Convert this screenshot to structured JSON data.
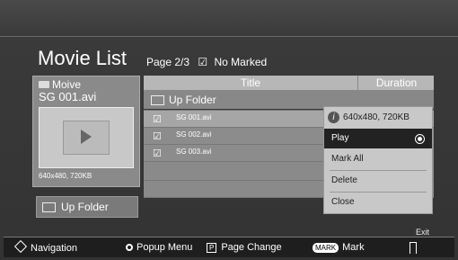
{
  "header": {
    "title": "Movie List",
    "page": "Page 2/3",
    "marked": "No Marked"
  },
  "preview": {
    "folder": "Moive",
    "filename": "SG 001.avi",
    "resolution": "640x480, 720KB"
  },
  "left_button": {
    "label": "Up Folder"
  },
  "list": {
    "col_title": "Title",
    "col_duration": "Duration",
    "up_folder": "Up Folder",
    "items": [
      {
        "name": "SG 001.avi"
      },
      {
        "name": "SG 002.avi"
      },
      {
        "name": "SG 003.avi"
      }
    ]
  },
  "popup": {
    "info": "640x480, 720KB",
    "items": [
      {
        "label": "Play"
      },
      {
        "label": "Mark All"
      },
      {
        "label": "Delete"
      },
      {
        "label": "Close"
      }
    ]
  },
  "exit": "Exit",
  "footer": {
    "navigation": "Navigation",
    "popup_menu": "Popup Menu",
    "page_change": "Page Change",
    "mark": "Mark",
    "mark_key": "MARK"
  }
}
